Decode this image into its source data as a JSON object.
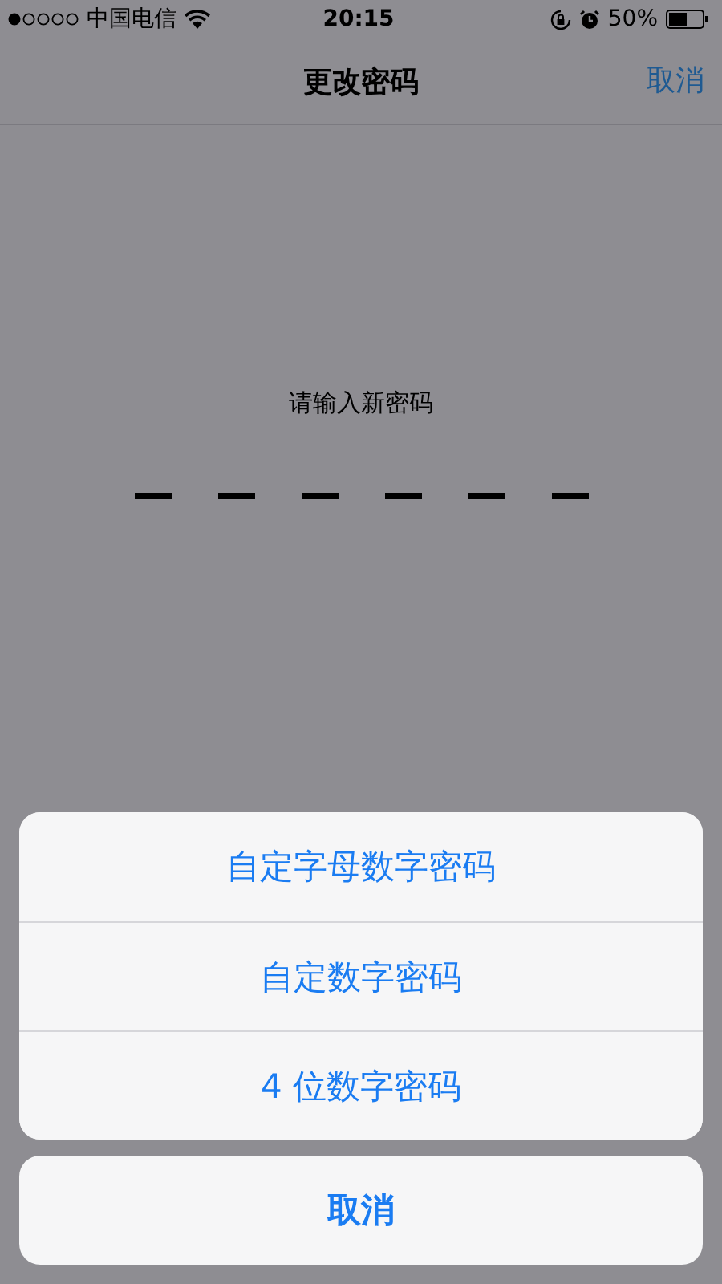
{
  "status_bar": {
    "carrier": "中国电信",
    "time": "20:15",
    "battery": "50%"
  },
  "nav_bar": {
    "title": "更改密码",
    "cancel": "取消"
  },
  "passcode": {
    "prompt": "请输入新密码",
    "slots": [
      {
        "filled": false
      },
      {
        "filled": false
      },
      {
        "filled": false
      },
      {
        "filled": false
      },
      {
        "filled": false
      },
      {
        "filled": false
      }
    ]
  },
  "action_sheet": {
    "options": [
      "自定字母数字密码",
      "自定数字密码",
      "4 位数字密码"
    ],
    "cancel": "取消"
  }
}
